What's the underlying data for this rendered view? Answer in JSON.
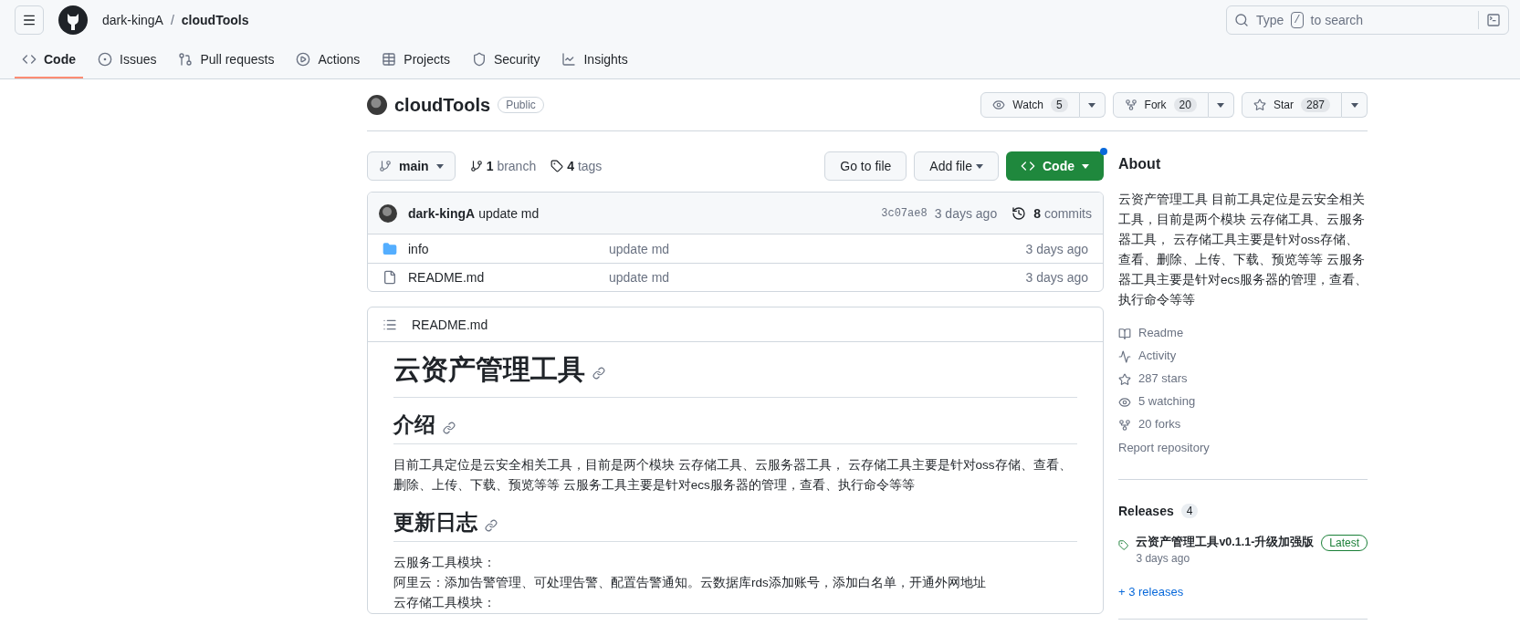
{
  "header": {
    "owner": "dark-kingA",
    "separator": "/",
    "repo": "cloudTools",
    "search": {
      "prefix": "Type",
      "key": "/",
      "suffix": "to search"
    }
  },
  "tabs": [
    {
      "label": "Code",
      "selected": true
    },
    {
      "label": "Issues",
      "selected": false
    },
    {
      "label": "Pull requests",
      "selected": false
    },
    {
      "label": "Actions",
      "selected": false
    },
    {
      "label": "Projects",
      "selected": false
    },
    {
      "label": "Security",
      "selected": false
    },
    {
      "label": "Insights",
      "selected": false
    }
  ],
  "repo": {
    "name": "cloudTools",
    "visibility": "Public",
    "actions": [
      {
        "label": "Watch",
        "count": "5"
      },
      {
        "label": "Fork",
        "count": "20"
      },
      {
        "label": "Star",
        "count": "287"
      }
    ]
  },
  "branch_bar": {
    "branch": "main",
    "branches": {
      "count": "1",
      "label": "branch"
    },
    "tags": {
      "count": "4",
      "label": "tags"
    },
    "buttons": [
      "Go to file",
      "Add file",
      "Code"
    ]
  },
  "latest_commit": {
    "author": "dark-kingA",
    "message": "update md",
    "sha": "3c07ae8",
    "time": "3 days ago",
    "commits_count": "8",
    "commits_label": "commits"
  },
  "files": [
    {
      "kind": "folder",
      "name": "info",
      "message": "update md",
      "time": "3 days ago"
    },
    {
      "kind": "file",
      "name": "README.md",
      "message": "update md",
      "time": "3 days ago"
    }
  ],
  "readme": {
    "filename": "README.md",
    "title": "云资产管理工具",
    "sections": [
      {
        "heading": "介绍",
        "lines": [
          "目前工具定位是云安全相关工具，目前是两个模块 云存储工具、云服务器工具， 云存储工具主要是针对oss存储、查看、删除、上传、下载、预览等等 云服务工具主要是针对ecs服务器的管理，查看、执行命令等等"
        ]
      },
      {
        "heading": "更新日志",
        "lines": [
          "云服务工具模块：",
          "阿里云：添加告警管理、可处理告警、配置告警通知。云数据库rds添加账号，添加白名单，开通外网地址",
          "云存储工具模块："
        ]
      }
    ]
  },
  "about": {
    "heading": "About",
    "description": "云资产管理工具 目前工具定位是云安全相关工具，目前是两个模块 云存储工具、云服务器工具， 云存储工具主要是针对oss存储、查看、删除、上传、下载、预览等等 云服务器工具主要是针对ecs服务器的管理，查看、执行命令等等",
    "links": [
      "Readme",
      "Activity",
      "287 stars",
      "5 watching",
      "20 forks"
    ],
    "report": "Report repository"
  },
  "releases": {
    "heading": "Releases",
    "count": "4",
    "latest": {
      "name": "云资产管理工具v0.1.1-升级加强版",
      "badge": "Latest",
      "time": "3 days ago"
    },
    "more": "+ 3 releases"
  }
}
